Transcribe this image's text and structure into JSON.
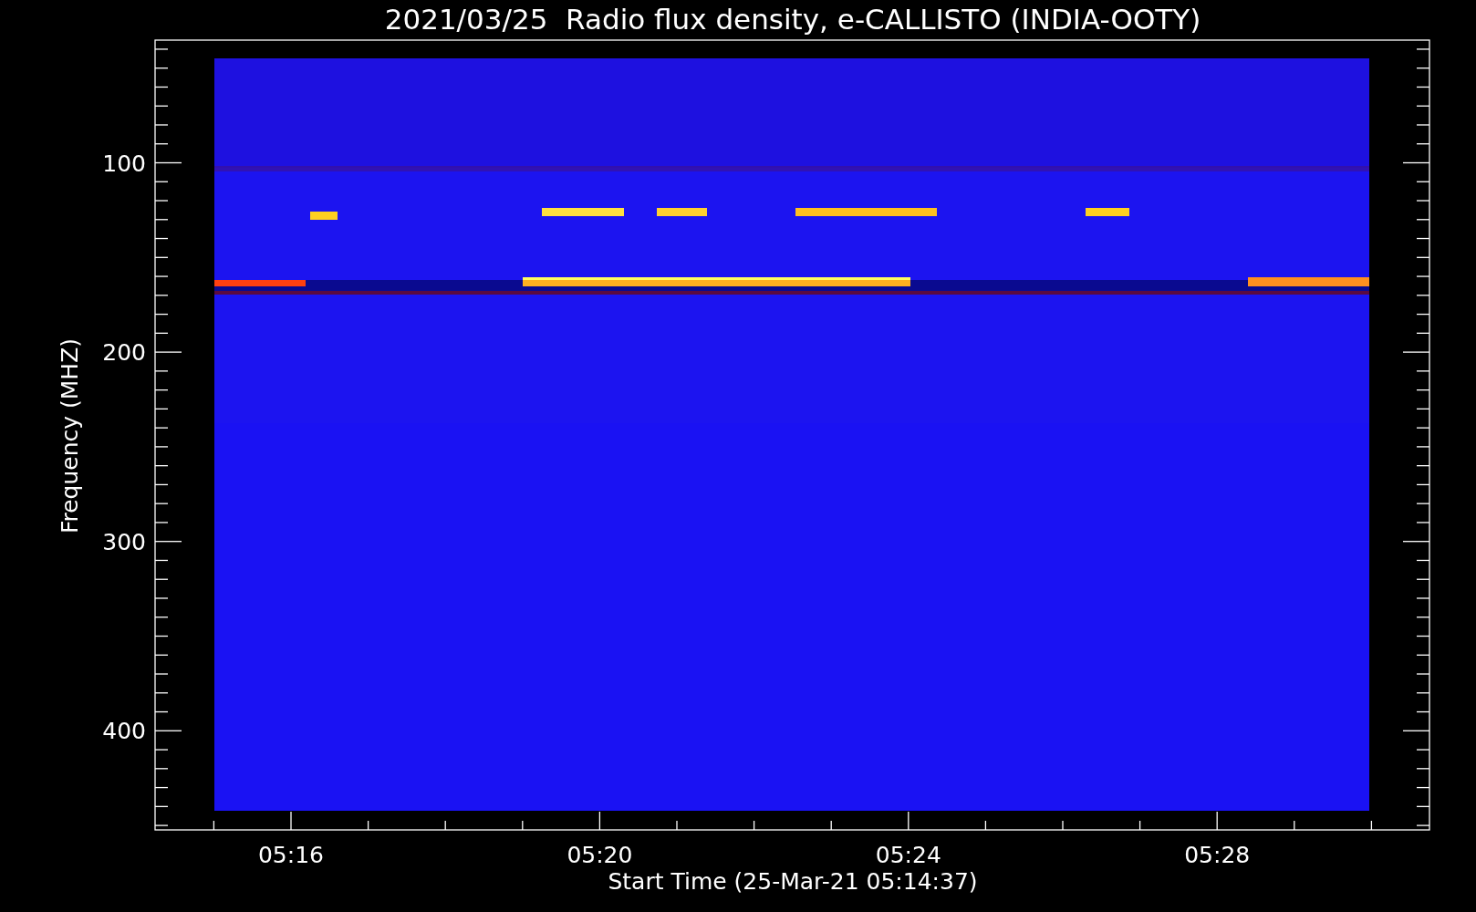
{
  "title": "2021/03/25  Radio flux density, e-CALLISTO (INDIA-OOTY)",
  "plot": {
    "ylabel": "Frequency (MHZ)",
    "xlabel": "Start Time (25-Mar-21 05:14:37)",
    "kind": "picture",
    "y_tick_labels": [
      "100",
      "200",
      "300",
      "400"
    ],
    "x_tick_labels": [
      "05:16",
      "05:20",
      "05:24",
      "05:28"
    ]
  }
}
